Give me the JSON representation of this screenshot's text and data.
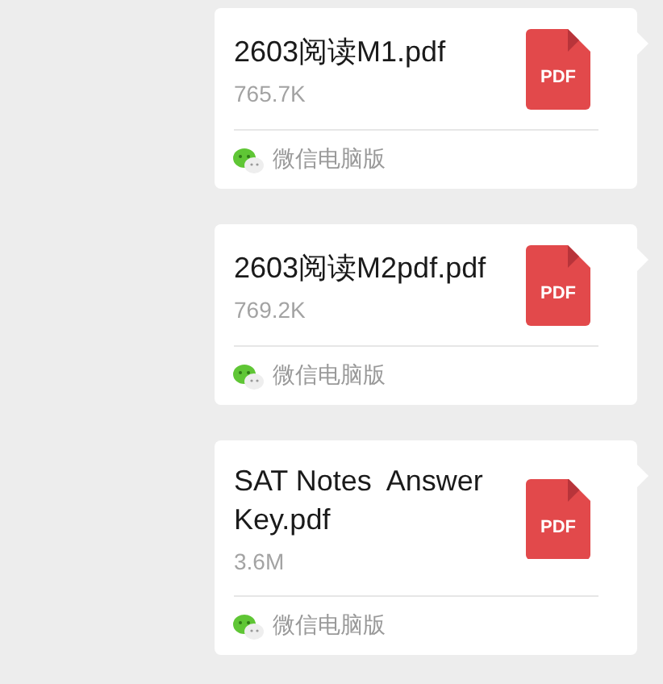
{
  "messages": [
    {
      "file_name": "2603阅读M1.pdf",
      "size": "765.7K",
      "file_type": "PDF",
      "source": "微信电脑版"
    },
    {
      "file_name": "2603阅读M2pdf.pdf",
      "size": "769.2K",
      "file_type": "PDF",
      "source": "微信电脑版"
    },
    {
      "file_name": "SAT Notes  Answer Key.pdf",
      "size": "3.6M",
      "file_type": "PDF",
      "source": "微信电脑版"
    }
  ]
}
